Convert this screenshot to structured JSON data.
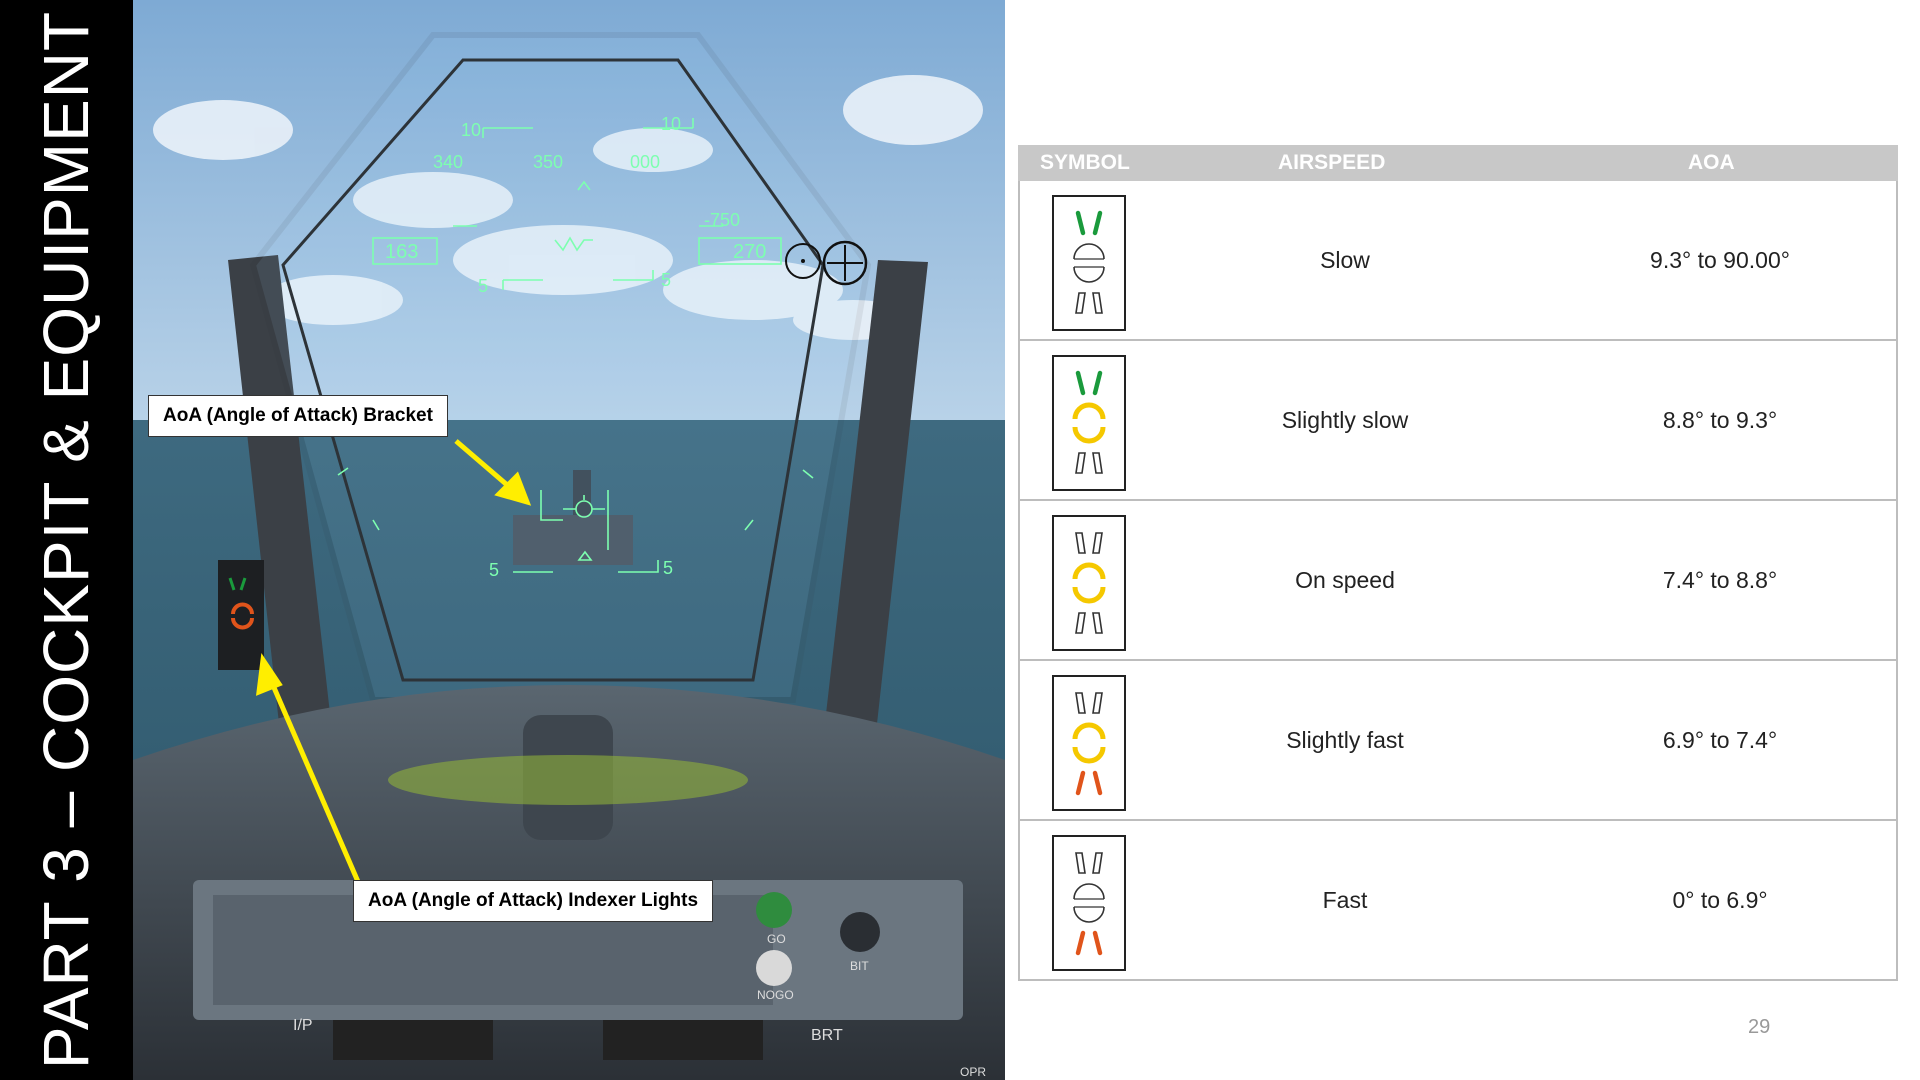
{
  "side_title": "PART 3 – COCKPIT & EQUIPMENT",
  "callouts": {
    "bracket": "AoA (Angle of Attack) Bracket",
    "indexer": "AoA (Angle of Attack) Indexer Lights"
  },
  "hud": {
    "pitch_upper_left": "10",
    "pitch_upper_right": "10",
    "heading_left": "340",
    "heading_center": "350",
    "heading_right": "000",
    "airspeed": "163",
    "altitude": "270",
    "vertical_speed": "-750",
    "pitch_lower_left": "5",
    "pitch_lower_right": "5",
    "bracket_left": "5",
    "bracket_right": "5"
  },
  "panel_labels": {
    "go": "GO",
    "nogo": "NOGO",
    "bit": "BIT",
    "ip": "I/P",
    "brt": "BRT",
    "opr": "OPR"
  },
  "table": {
    "headers": [
      "SYMBOL",
      "AIRSPEED",
      "AOA"
    ],
    "rows": [
      {
        "airspeed": "Slow",
        "aoa": "9.3° to 90.00°",
        "symbol": {
          "top": "green",
          "mid": "off",
          "bottom": "off"
        }
      },
      {
        "airspeed": "Slightly slow",
        "aoa": "8.8° to 9.3°",
        "symbol": {
          "top": "green",
          "mid": "yellow",
          "bottom": "off"
        }
      },
      {
        "airspeed": "On speed",
        "aoa": "7.4° to 8.8°",
        "symbol": {
          "top": "off",
          "mid": "yellow",
          "bottom": "off"
        }
      },
      {
        "airspeed": "Slightly fast",
        "aoa": "6.9° to 7.4°",
        "symbol": {
          "top": "off",
          "mid": "yellow",
          "bottom": "orange"
        }
      },
      {
        "airspeed": "Fast",
        "aoa": "0° to 6.9°",
        "symbol": {
          "top": "off",
          "mid": "off",
          "bottom": "orange"
        }
      }
    ]
  },
  "colors": {
    "green": "#1a9a3c",
    "yellow": "#f5c800",
    "orange": "#e0541b",
    "hud": "#7dffb0",
    "arrow": "#ffee00"
  },
  "page_number": "29"
}
